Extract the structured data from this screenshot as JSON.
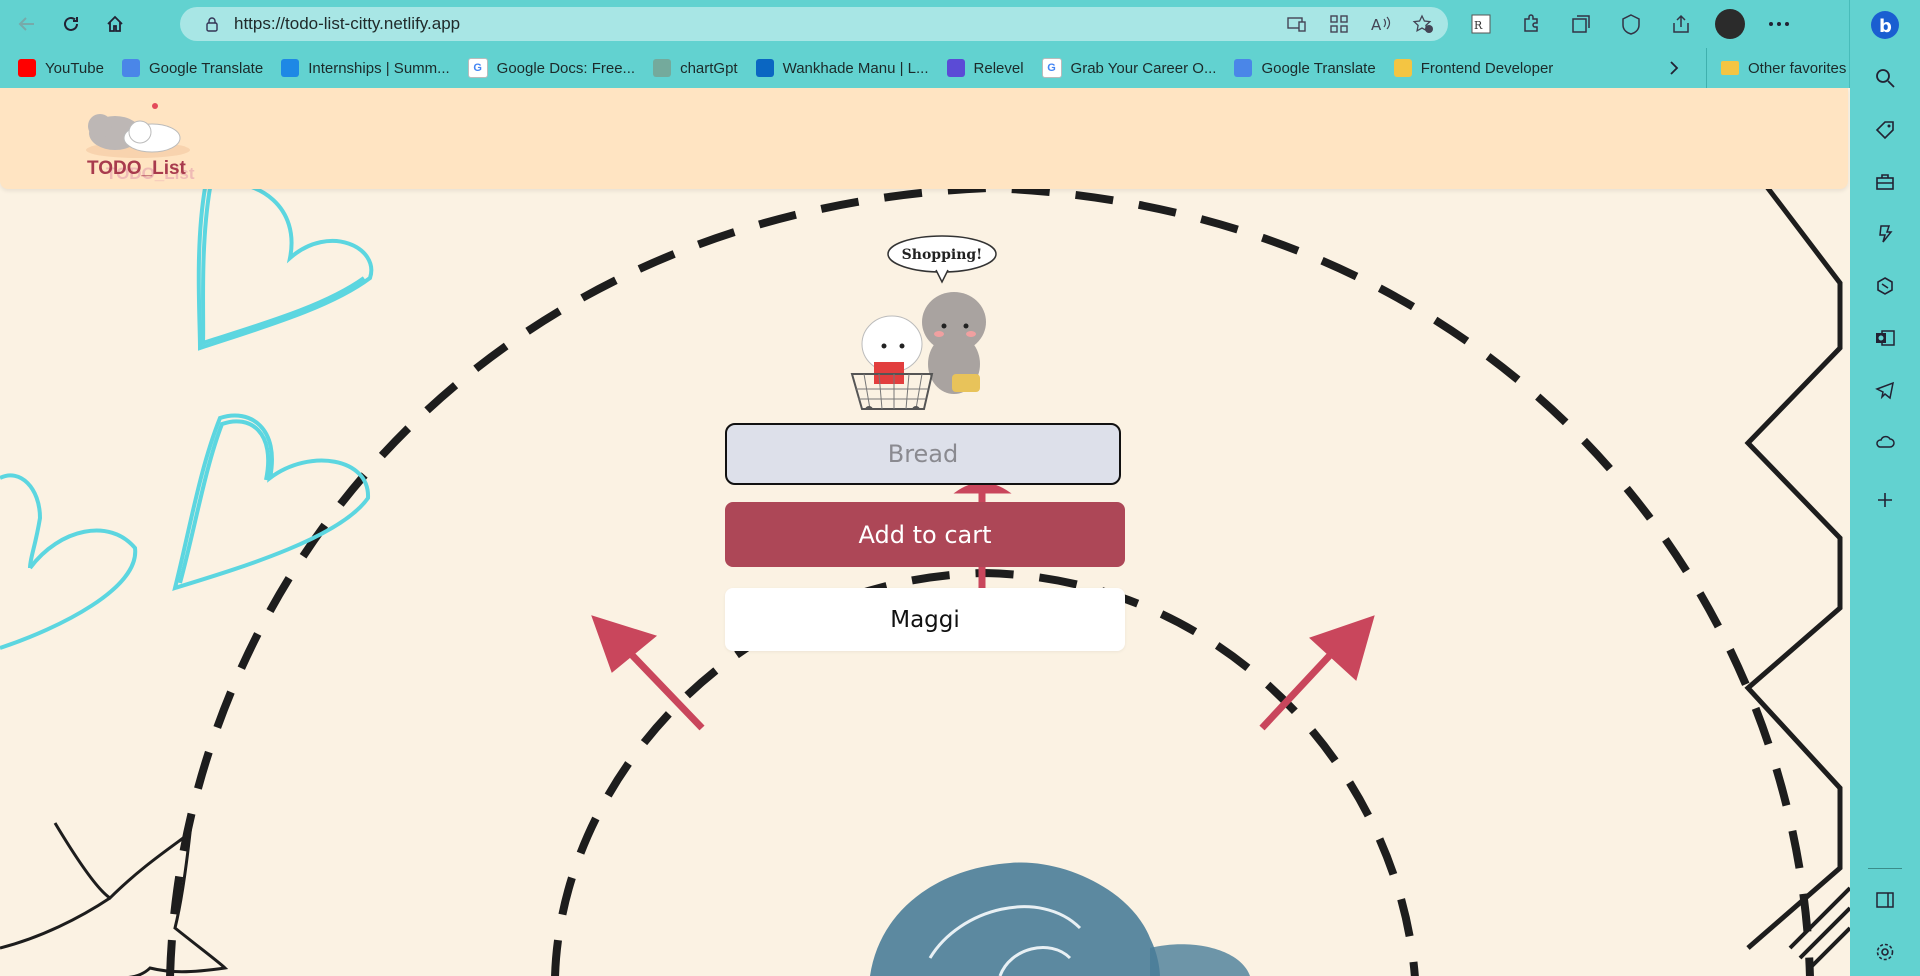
{
  "browser": {
    "url": "https://todo-list-citty.netlify.app",
    "bookmarks": [
      {
        "label": "YouTube",
        "icon": "youtube-icon",
        "color": "#ff0000"
      },
      {
        "label": "Google Translate",
        "icon": "google-translate-icon",
        "color": "#4a86e8"
      },
      {
        "label": "Internships | Summ...",
        "icon": "internshala-icon",
        "color": "#1e88e5"
      },
      {
        "label": "Google Docs: Free...",
        "icon": "google-icon",
        "color": "#ffffff"
      },
      {
        "label": "chartGpt",
        "icon": "chatgpt-icon",
        "color": "#74aa9c"
      },
      {
        "label": "Wankhade Manu | L...",
        "icon": "linkedin-icon",
        "color": "#0a66c2"
      },
      {
        "label": "Relevel",
        "icon": "relevel-icon",
        "color": "#5b4bd6"
      },
      {
        "label": "Grab Your Career O...",
        "icon": "google-icon",
        "color": "#ffffff"
      },
      {
        "label": "Google Translate",
        "icon": "google-translate-icon",
        "color": "#4a86e8"
      },
      {
        "label": "Frontend Developer",
        "icon": "folder-icon",
        "color": "#f4c542"
      }
    ],
    "other_favorites": "Other favorites"
  },
  "app": {
    "logo_text": "TODO_List",
    "speech_bubble": "Shopping!",
    "input_placeholder": "Bread",
    "add_button_label": "Add to cart",
    "items": [
      "Maggi"
    ]
  },
  "colors": {
    "chrome": "#62d2d0",
    "header": "#ffe4c2",
    "page_bg": "#fbf2e3",
    "accent": "#ad4757",
    "arrow": "#c9465c",
    "heart": "#5cd6e0"
  }
}
